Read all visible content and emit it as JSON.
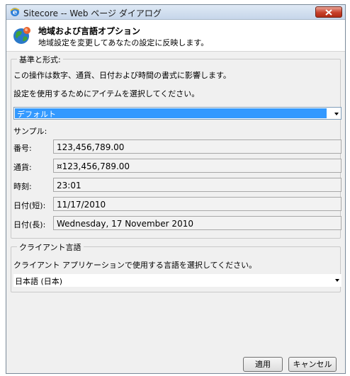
{
  "window": {
    "title": "Sitecore -- Web ページ ダイアログ"
  },
  "header": {
    "title": "地域および言語オプション",
    "subtitle": "地域設定を変更してあなたの設定に反映します。"
  },
  "format_group": {
    "legend": "基準と形式:",
    "description": "この操作は数字、通貨、日付および時間の書式に影響します。",
    "instruction": "設定を使用するためにアイテムを選択してください。",
    "selected_format": "デフォルト",
    "sample_label": "サンプル:",
    "samples": [
      {
        "label": "番号:",
        "value": "123,456,789.00"
      },
      {
        "label": "通貨:",
        "value": "¤123,456,789.00"
      },
      {
        "label": "時刻:",
        "value": "23:01"
      },
      {
        "label": "日付(短):",
        "value": "11/17/2010"
      },
      {
        "label": "日付(長):",
        "value": "Wednesday, 17 November 2010"
      }
    ]
  },
  "language_group": {
    "legend": "クライアント言語",
    "instruction": "クライアント アプリケーションで使用する言語を選択してください。",
    "selected_language": "日本語 (日本)"
  },
  "buttons": {
    "apply": "適用",
    "cancel": "キャンセル"
  },
  "colors": {
    "selection": "#3399ff",
    "close_button": "#c8412b"
  }
}
